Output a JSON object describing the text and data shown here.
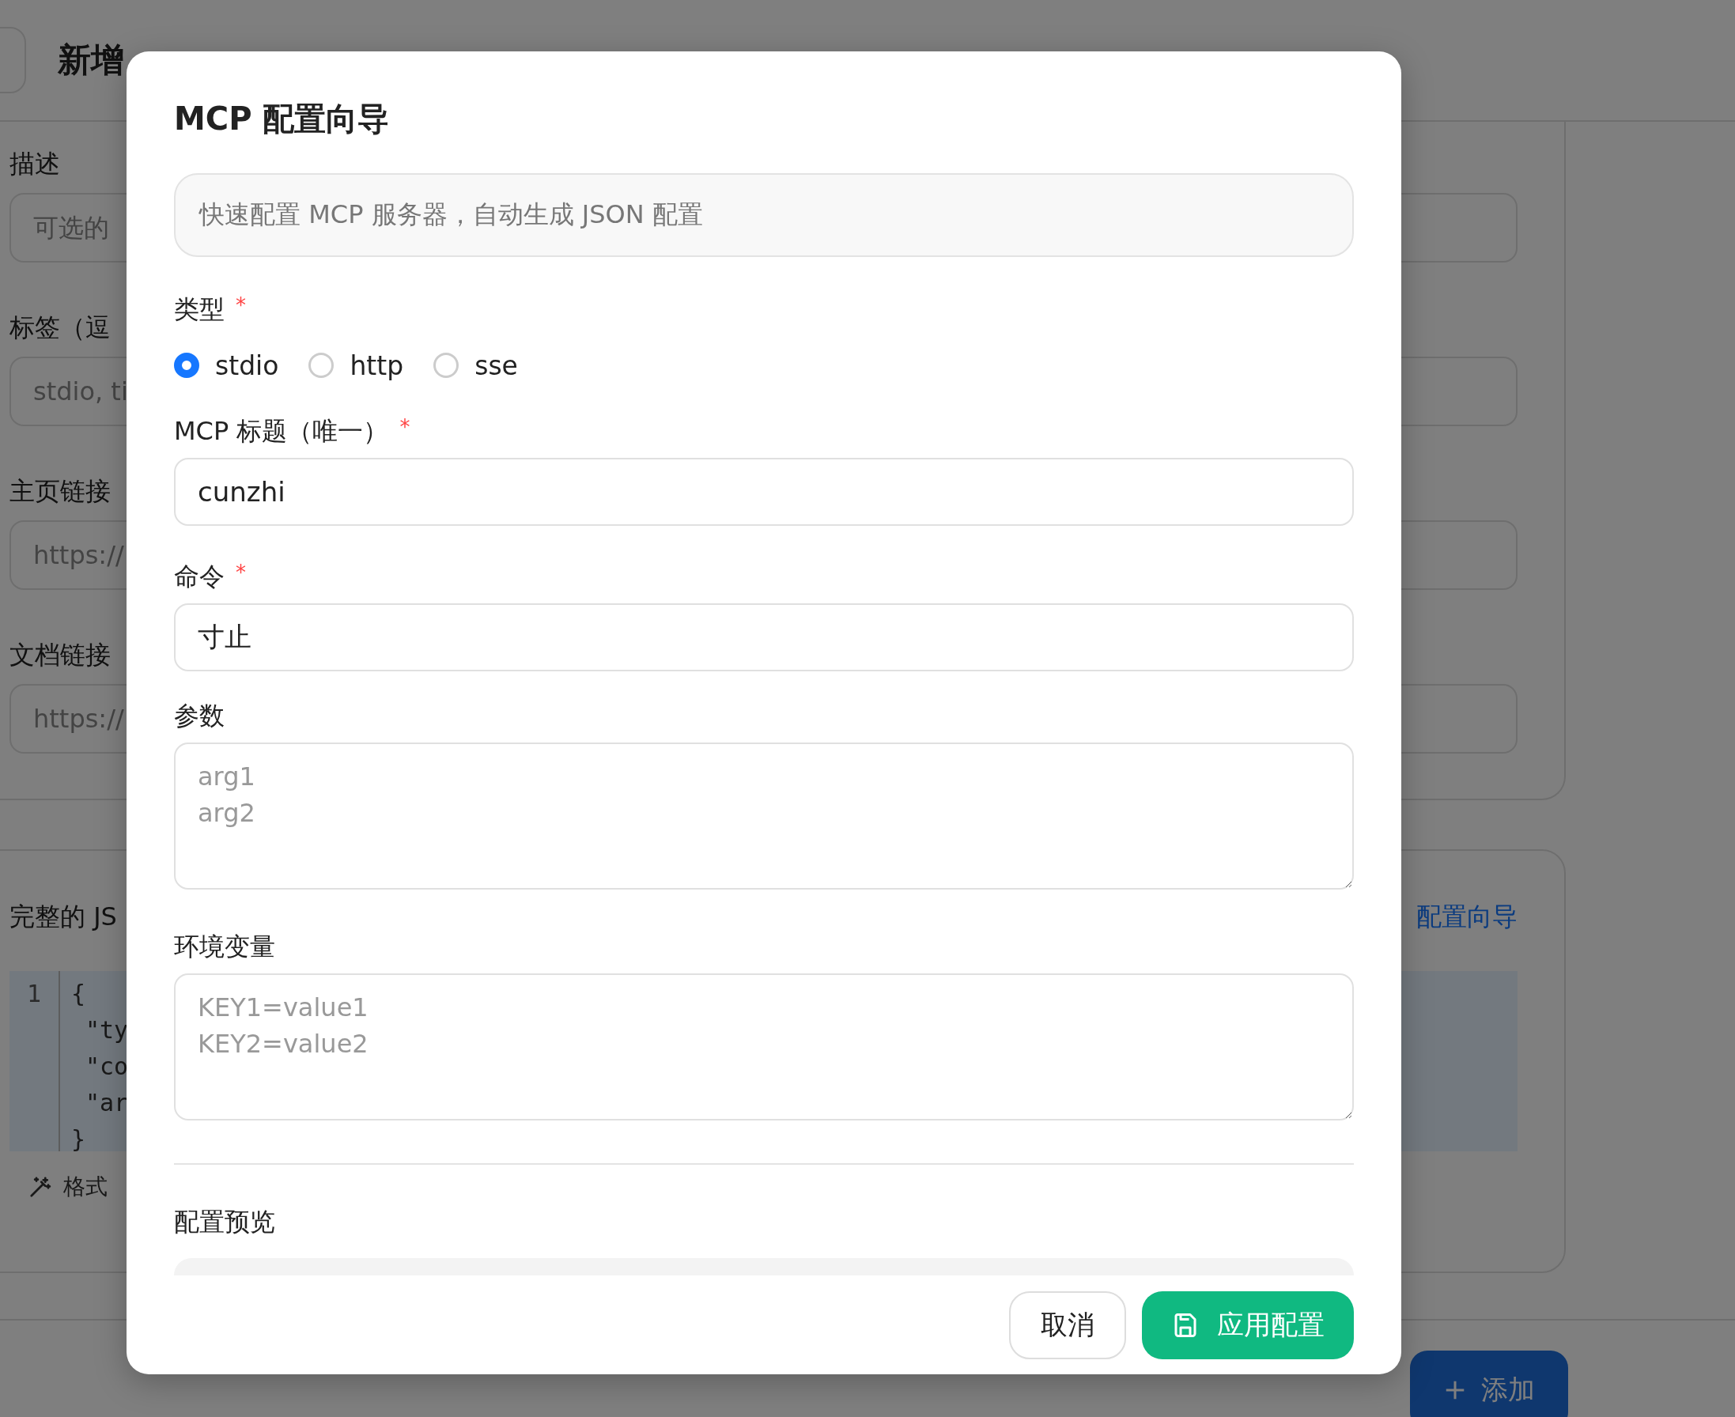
{
  "background": {
    "page_title": "新增",
    "fields": [
      {
        "label": "描述",
        "placeholder": "可选的"
      },
      {
        "label": "标签（逗",
        "placeholder": "stdio, ti"
      },
      {
        "label": "主页链接",
        "placeholder": "https://"
      },
      {
        "label": "文档链接",
        "placeholder": "https://"
      }
    ],
    "json_section": {
      "label": "完整的 JS",
      "link": "配置向导",
      "line_numbers": [
        "1"
      ],
      "code_lines": [
        "{",
        "\"ty",
        "\"co",
        "\"ar",
        "}"
      ],
      "format_button": "格式"
    },
    "add_button": "添加"
  },
  "dialog": {
    "title": "MCP 配置向导",
    "info": "快速配置 MCP 服务器，自动生成 JSON 配置",
    "fields": [
      {
        "kind": "radio",
        "label": "类型",
        "required_mark": "*",
        "options": [
          {
            "label": "stdio",
            "selected": true
          },
          {
            "label": "http",
            "selected": false
          },
          {
            "label": "sse",
            "selected": false
          }
        ]
      },
      {
        "kind": "input",
        "label": "MCP 标题（唯一）",
        "required_mark": "*",
        "value": "cunzhi"
      },
      {
        "kind": "input",
        "label": "命令",
        "required_mark": "*",
        "value": "寸止"
      },
      {
        "kind": "textarea",
        "label": "参数",
        "placeholder": "arg1\narg2"
      },
      {
        "kind": "textarea",
        "label": "环境变量",
        "placeholder": "KEY1=value1\nKEY2=value2"
      }
    ],
    "preview_label": "配置预览",
    "buttons": [
      {
        "label": "取消",
        "kind": "secondary"
      },
      {
        "label": "应用配置",
        "kind": "primary"
      }
    ]
  }
}
